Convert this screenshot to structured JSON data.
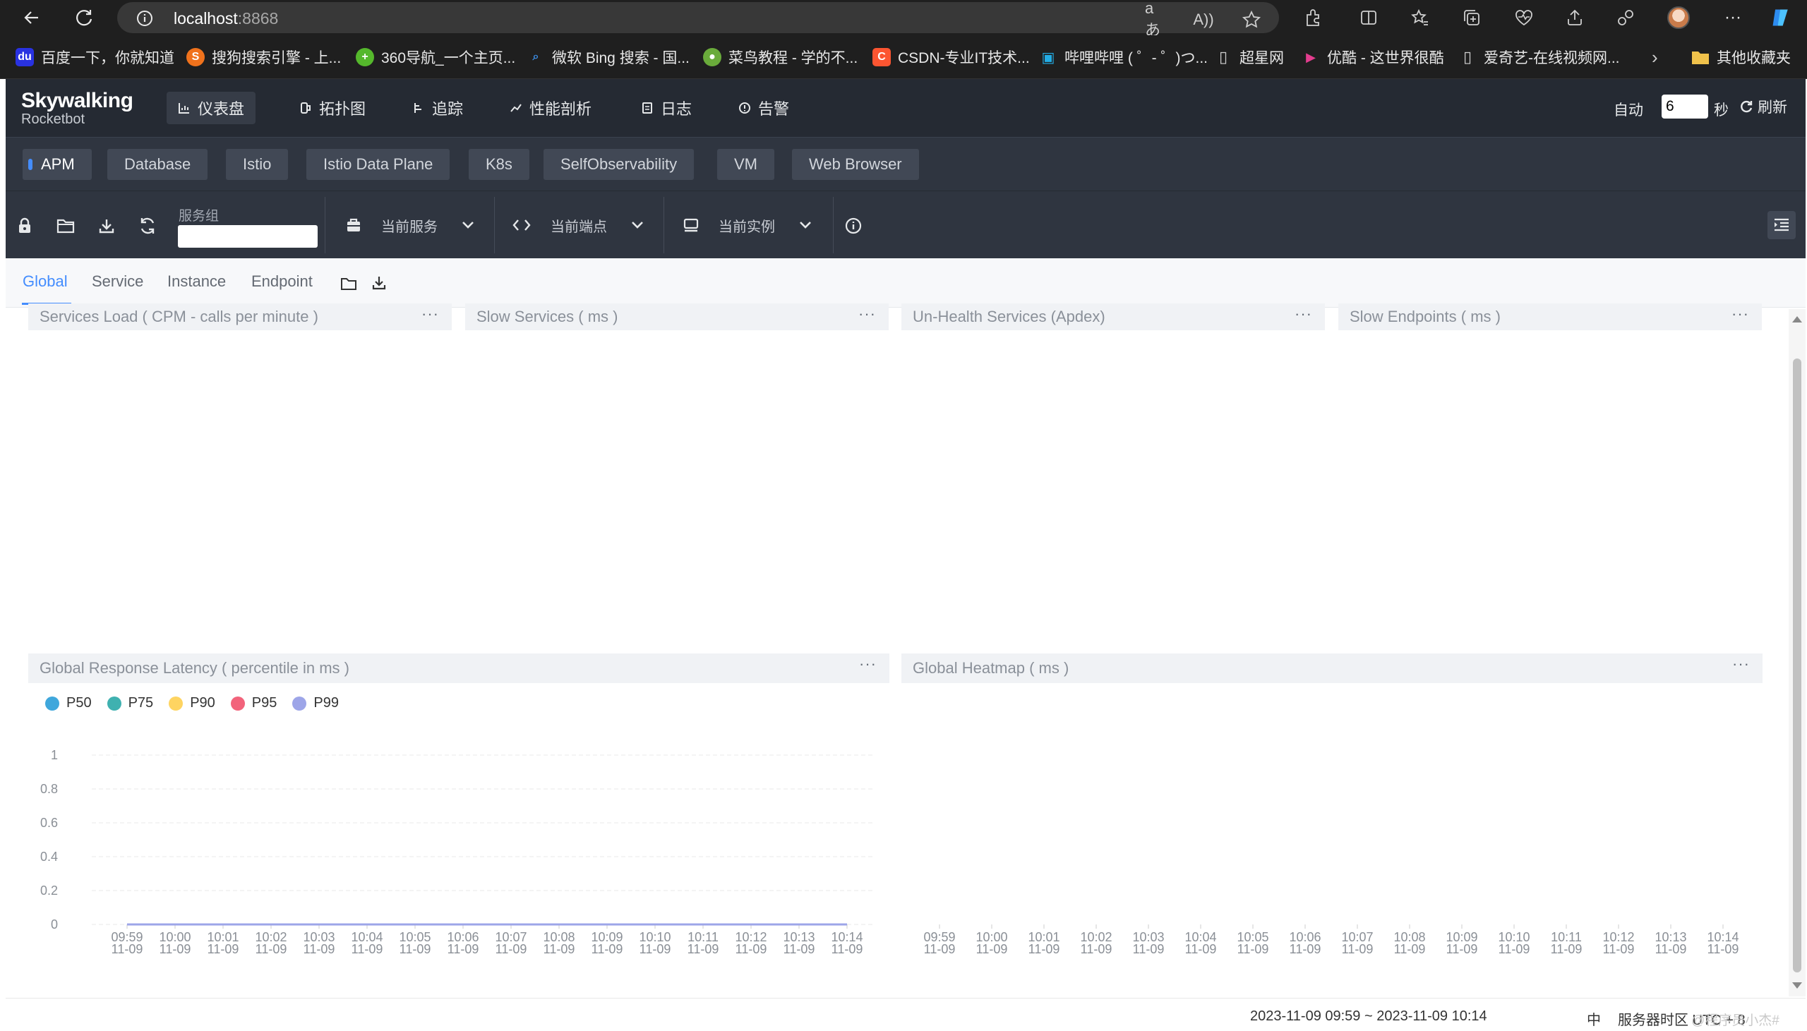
{
  "browser": {
    "url_host": "localhost",
    "url_port": ":8868"
  },
  "bookmarks": [
    {
      "label": "百度一下，你就知道",
      "icon": "baidu-icon",
      "color": "#2932e1",
      "glyph": "du"
    },
    {
      "label": "搜狗搜索引擎 - 上...",
      "icon": "sogou-icon",
      "color": "#f0721c",
      "glyph": "S"
    },
    {
      "label": "360导航_一个主页...",
      "icon": "360-icon",
      "color": "#55b82c",
      "glyph": "+"
    },
    {
      "label": "微软 Bing 搜索 - 国...",
      "icon": "bing-search-icon",
      "color": "#1f1f1f",
      "glyph": "⌕"
    },
    {
      "label": "菜鸟教程 - 学的不...",
      "icon": "runoob-icon",
      "color": "#6aab3b",
      "glyph": "●"
    },
    {
      "label": "CSDN-专业IT技术...",
      "icon": "csdn-icon",
      "color": "#fc5531",
      "glyph": "C"
    },
    {
      "label": "哔哩哔哩 ( ゜- ゜)つ...",
      "icon": "bilibili-icon",
      "color": "#1f1f1f",
      "glyph": "▣"
    },
    {
      "label": "超星网",
      "icon": "page-icon",
      "color": "#1f1f1f",
      "glyph": "▯"
    },
    {
      "label": "优酷 - 这世界很酷",
      "icon": "youku-icon",
      "color": "#1f1f1f",
      "glyph": "▶"
    },
    {
      "label": "爱奇艺-在线视频网...",
      "icon": "page-icon",
      "color": "#1f1f1f",
      "glyph": "▯"
    }
  ],
  "bookmarks_other": "其他收藏夹",
  "app": {
    "logo_main": "Skywalking",
    "logo_sub": "Rocketbot",
    "nav": [
      {
        "label": "仪表盘",
        "icon": "dashboard-icon",
        "active": true
      },
      {
        "label": "拓扑图",
        "icon": "topology-icon",
        "active": false
      },
      {
        "label": "追踪",
        "icon": "trace-icon",
        "active": false
      },
      {
        "label": "性能剖析",
        "icon": "profile-icon",
        "active": false
      },
      {
        "label": "日志",
        "icon": "log-icon",
        "active": false
      },
      {
        "label": "告警",
        "icon": "alarm-icon",
        "active": false
      }
    ],
    "auto_label": "自动",
    "auto_seconds": "6",
    "seconds_label": "秒",
    "refresh_label": "刷新"
  },
  "layers": [
    "APM",
    "Database",
    "Istio",
    "Istio Data Plane",
    "K8s",
    "SelfObservability",
    "VM",
    "Web Browser"
  ],
  "toolbar": {
    "service_group_label": "服务组",
    "service_group_value": "",
    "current_service": "当前服务",
    "current_endpoint": "当前端点",
    "current_instance": "当前实例"
  },
  "dashboard_tabs": [
    "Global",
    "Service",
    "Instance",
    "Endpoint"
  ],
  "widgets": {
    "services_load": "Services Load ( CPM - calls per minute )",
    "slow_services": "Slow Services ( ms )",
    "unhealth_services": "Un-Health Services (Apdex)",
    "slow_endpoints": "Slow Endpoints ( ms )",
    "global_latency": "Global Response Latency ( percentile in ms )",
    "global_heatmap": "Global Heatmap ( ms )",
    "more": "···"
  },
  "chart_data": [
    {
      "type": "line",
      "title": "Global Response Latency ( percentile in ms )",
      "legend_position": "top-left",
      "x": [
        "09:59\n11-09",
        "10:00\n11-09",
        "10:01\n11-09",
        "10:02\n11-09",
        "10:03\n11-09",
        "10:04\n11-09",
        "10:05\n11-09",
        "10:06\n11-09",
        "10:07\n11-09",
        "10:08\n11-09",
        "10:09\n11-09",
        "10:10\n11-09",
        "10:11\n11-09",
        "10:12\n11-09",
        "10:13\n11-09",
        "10:14\n11-09"
      ],
      "y_ticks": [
        "0",
        "0.2",
        "0.4",
        "0.6",
        "0.8",
        "1"
      ],
      "ylim": [
        0,
        1
      ],
      "grid": true,
      "series": [
        {
          "name": "P50",
          "color": "#3fa7dc",
          "values": [
            0,
            0,
            0,
            0,
            0,
            0,
            0,
            0,
            0,
            0,
            0,
            0,
            0,
            0,
            0,
            0
          ]
        },
        {
          "name": "P75",
          "color": "#3fb1b0",
          "values": [
            0,
            0,
            0,
            0,
            0,
            0,
            0,
            0,
            0,
            0,
            0,
            0,
            0,
            0,
            0,
            0
          ]
        },
        {
          "name": "P90",
          "color": "#fed461",
          "values": [
            0,
            0,
            0,
            0,
            0,
            0,
            0,
            0,
            0,
            0,
            0,
            0,
            0,
            0,
            0,
            0
          ]
        },
        {
          "name": "P95",
          "color": "#f2637b",
          "values": [
            0,
            0,
            0,
            0,
            0,
            0,
            0,
            0,
            0,
            0,
            0,
            0,
            0,
            0,
            0,
            0
          ]
        },
        {
          "name": "P99",
          "color": "#9da5e8",
          "values": [
            0,
            0,
            0,
            0,
            0,
            0,
            0,
            0,
            0,
            0,
            0,
            0,
            0,
            0,
            0,
            0
          ]
        }
      ]
    },
    {
      "type": "heatmap",
      "title": "Global Heatmap ( ms )",
      "x": [
        "09:59\n11-09",
        "10:00\n11-09",
        "10:01\n11-09",
        "10:02\n11-09",
        "10:03\n11-09",
        "10:04\n11-09",
        "10:05\n11-09",
        "10:06\n11-09",
        "10:07\n11-09",
        "10:08\n11-09",
        "10:09\n11-09",
        "10:10\n11-09",
        "10:11\n11-09",
        "10:12\n11-09",
        "10:13\n11-09",
        "10:14\n11-09"
      ],
      "values": []
    }
  ],
  "footer": {
    "time_range": "2023-11-09 09:59 ~ 2023-11-09 10:14",
    "lang": "中",
    "timezone": "服务器时区 UTC + 8"
  },
  "watermark": "@程序员小杰#"
}
